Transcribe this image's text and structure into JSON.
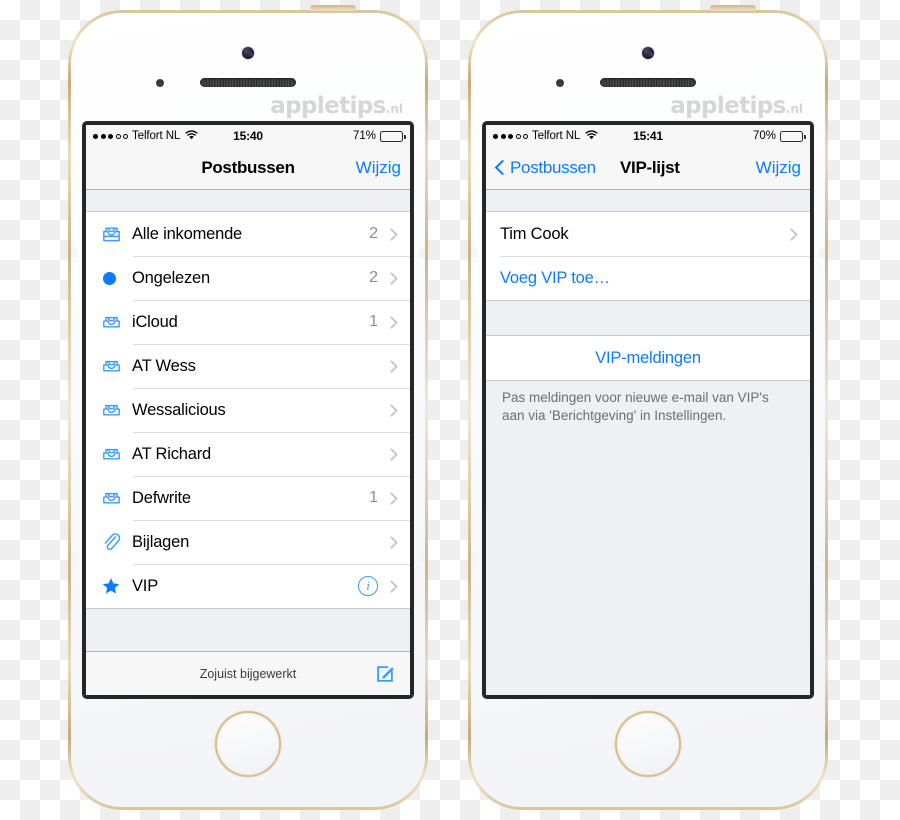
{
  "watermark": {
    "name": "appletips",
    "tld": ".nl"
  },
  "phone_left": {
    "device_name": "iPhone 5s Gold",
    "status_bar": {
      "signal_filled": 3,
      "signal_hollow": 2,
      "carrier": "Telfort NL",
      "wifi": "wifi-icon",
      "time": "15:40",
      "battery_percent": "71%",
      "battery_level": 71
    },
    "nav": {
      "title": "Postbussen",
      "right_button": "Wijzig"
    },
    "list": [
      {
        "icon": "mailbox-stacked-icon",
        "label": "Alle inkomende",
        "count": "2",
        "chevron": true
      },
      {
        "icon": "unread-dot-icon",
        "label": "Ongelezen",
        "count": "2",
        "chevron": true
      },
      {
        "icon": "mailbox-icon",
        "label": "iCloud",
        "count": "1",
        "chevron": true
      },
      {
        "icon": "mailbox-icon",
        "label": "AT Wess",
        "count": "",
        "chevron": true
      },
      {
        "icon": "mailbox-icon",
        "label": "Wessalicious",
        "count": "",
        "chevron": true
      },
      {
        "icon": "mailbox-icon",
        "label": "AT Richard",
        "count": "",
        "chevron": true
      },
      {
        "icon": "mailbox-icon",
        "label": "Defwrite",
        "count": "1",
        "chevron": true
      },
      {
        "icon": "paperclip-icon",
        "label": "Bijlagen",
        "count": "",
        "chevron": true
      },
      {
        "icon": "star-icon",
        "label": "VIP",
        "count": "",
        "chevron": true,
        "info": true
      }
    ],
    "toolbar": {
      "status_text": "Zojuist bijgewerkt",
      "compose_button": "compose-icon"
    }
  },
  "phone_right": {
    "device_name": "iPhone 5s Gold",
    "status_bar": {
      "signal_filled": 3,
      "signal_hollow": 2,
      "carrier": "Telfort NL",
      "wifi": "wifi-icon",
      "time": "15:41",
      "battery_percent": "70%",
      "battery_level": 70
    },
    "nav": {
      "back_label": "Postbussen",
      "title": "VIP-lijst",
      "right_button": "Wijzig"
    },
    "vip_list": [
      {
        "label": "Tim Cook",
        "chevron": true,
        "blue": false
      },
      {
        "label": "Voeg VIP toe…",
        "chevron": false,
        "blue": true
      }
    ],
    "notifications": {
      "action_label": "VIP-meldingen",
      "footnote": "Pas meldingen voor nieuwe e-mail van VIP's aan via 'Berichtgeving' in Instellingen."
    }
  },
  "colors": {
    "ios_blue": "#0b7cff",
    "gold_bezel": "#cdb488",
    "table_bg": "#ffffff",
    "group_bg": "#eff0f4",
    "separator": "#c8c7cc",
    "footnote_text": "#6d6d72"
  }
}
